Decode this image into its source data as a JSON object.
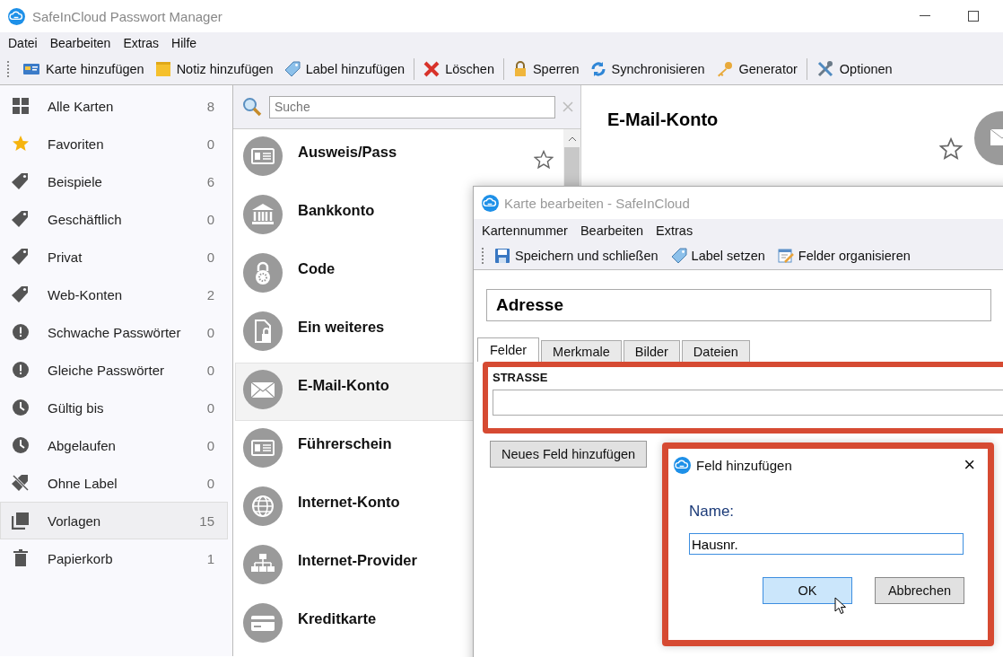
{
  "window": {
    "title": "SafeInCloud Passwort Manager"
  },
  "menu": [
    "Datei",
    "Bearbeiten",
    "Extras",
    "Hilfe"
  ],
  "toolbar_groups": [
    {
      "items": [
        {
          "label": "Karte hinzufügen",
          "kind": "card"
        },
        {
          "label": "Notiz hinzufügen",
          "kind": "note"
        },
        {
          "label": "Label hinzufügen",
          "kind": "tag"
        }
      ]
    },
    {
      "items": [
        {
          "label": "Löschen",
          "kind": "delete"
        }
      ]
    },
    {
      "items": [
        {
          "label": "Sperren",
          "kind": "lock"
        },
        {
          "label": "Synchronisieren",
          "kind": "sync"
        },
        {
          "label": "Generator",
          "kind": "key"
        }
      ]
    },
    {
      "items": [
        {
          "label": "Optionen",
          "kind": "tools"
        }
      ]
    }
  ],
  "sidebar": {
    "items": [
      {
        "label": "Alle Karten",
        "count": "8",
        "kind": "grid",
        "selected": false
      },
      {
        "label": "Favoriten",
        "count": "0",
        "kind": "star",
        "selected": false
      },
      {
        "label": "Beispiele",
        "count": "6",
        "kind": "tag",
        "selected": false
      },
      {
        "label": "Geschäftlich",
        "count": "0",
        "kind": "tag",
        "selected": false
      },
      {
        "label": "Privat",
        "count": "0",
        "kind": "tag",
        "selected": false
      },
      {
        "label": "Web-Konten",
        "count": "2",
        "kind": "tag",
        "selected": false
      },
      {
        "label": "Schwache Passwörter",
        "count": "0",
        "kind": "alert",
        "selected": false
      },
      {
        "label": "Gleiche Passwörter",
        "count": "0",
        "kind": "alert",
        "selected": false
      },
      {
        "label": "Gültig bis",
        "count": "0",
        "kind": "clock",
        "selected": false
      },
      {
        "label": "Abgelaufen",
        "count": "0",
        "kind": "clock",
        "selected": false
      },
      {
        "label": "Ohne Label",
        "count": "0",
        "kind": "notag",
        "selected": false
      },
      {
        "label": "Vorlagen",
        "count": "15",
        "kind": "stack",
        "selected": true
      },
      {
        "label": "Papierkorb",
        "count": "1",
        "kind": "trash",
        "selected": false
      }
    ]
  },
  "search": {
    "placeholder": "Suche"
  },
  "cards": [
    {
      "title": "Ausweis/Pass",
      "kind": "id",
      "selected": false,
      "star": true
    },
    {
      "title": "Bankkonto",
      "kind": "bank",
      "selected": false,
      "star": false
    },
    {
      "title": "Code",
      "kind": "lock",
      "selected": false,
      "star": false
    },
    {
      "title": "Ein weiteres",
      "kind": "file",
      "selected": false,
      "star": false
    },
    {
      "title": "E-Mail-Konto",
      "kind": "mail",
      "selected": true,
      "star": false
    },
    {
      "title": "Führerschein",
      "kind": "id",
      "selected": false,
      "star": false
    },
    {
      "title": "Internet-Konto",
      "kind": "globe",
      "selected": false,
      "star": false
    },
    {
      "title": "Internet-Provider",
      "kind": "network",
      "selected": false,
      "star": false
    },
    {
      "title": "Kreditkarte",
      "kind": "credit",
      "selected": false,
      "star": false
    }
  ],
  "detail": {
    "title": "E-Mail-Konto"
  },
  "edit_dialog": {
    "title": "Karte bearbeiten - SafeInCloud",
    "menu": [
      "Kartennummer",
      "Bearbeiten",
      "Extras"
    ],
    "toolbar": [
      {
        "label": "Speichern und schließen",
        "kind": "save"
      },
      {
        "label": "Label setzen",
        "kind": "tag"
      },
      {
        "label": "Felder organisieren",
        "kind": "form"
      }
    ],
    "name": "Adresse",
    "tabs": [
      {
        "label": "Felder",
        "selected": true
      },
      {
        "label": "Merkmale",
        "selected": false
      },
      {
        "label": "Bilder",
        "selected": false
      },
      {
        "label": "Dateien",
        "selected": false
      }
    ],
    "field": {
      "label": "STRASSE",
      "highlighted": true
    },
    "add_button": "Neues Feld hinzufügen"
  },
  "add_dialog": {
    "title": "Feld hinzufügen",
    "close": "×",
    "highlighted": true,
    "name_label": "Name:",
    "value": "Hausnr.",
    "buttons": [
      {
        "label": "OK",
        "hover": true
      },
      {
        "label": "Abbrechen",
        "hover": false
      }
    ]
  }
}
